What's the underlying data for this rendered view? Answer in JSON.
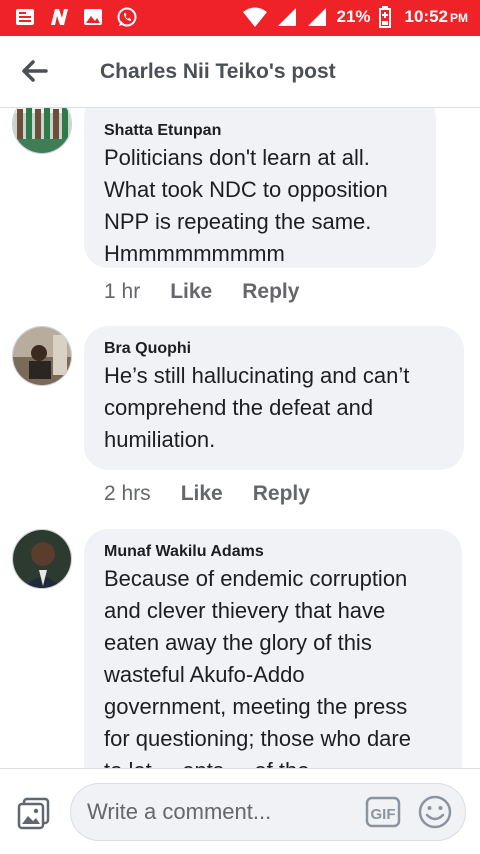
{
  "status_bar": {
    "notification_icons": [
      "news-icon",
      "n-app-icon",
      "gallery-icon",
      "whatsapp-icon"
    ],
    "battery": "21%",
    "time": "10:52",
    "ampm": "PM",
    "bar_color": "#ef2228"
  },
  "header": {
    "title": "Charles Nii Teiko's post",
    "back_icon": "arrow-left-icon"
  },
  "comments": [
    {
      "author": "Shatta Etunpan",
      "lines": [
        "Politicians don't learn at all.",
        "What took NDC to opposition",
        "NPP is repeating the same.",
        "Hmmmmmmmmm"
      ],
      "time": "1 hr",
      "like": "Like",
      "reply": "Reply"
    },
    {
      "author": "Bra Quophi",
      "lines": [
        "He’s still hallucinating and can’t",
        "comprehend the defeat and",
        "humiliation."
      ],
      "time": "2 hrs",
      "like": "Like",
      "reply": "Reply"
    },
    {
      "author": "Munaf Wakilu Adams",
      "lines": [
        "Because of endemic corruption",
        "and clever thievery that have",
        "eaten away the glory of this",
        "wasteful Akufo-Addo",
        "government, meeting the press",
        "for questioning; those who dare",
        "to let ... ents ... of the"
      ],
      "time": "",
      "like": "",
      "reply": ""
    }
  ],
  "composer": {
    "placeholder": "Write a comment...",
    "gif_label": "GIF",
    "photo_icon": "photo-icon",
    "emoji_icon": "emoji-icon"
  },
  "colors": {
    "bubble": "#f0f2f5",
    "meta_text": "#65676b",
    "title_text": "#4b4f56"
  }
}
